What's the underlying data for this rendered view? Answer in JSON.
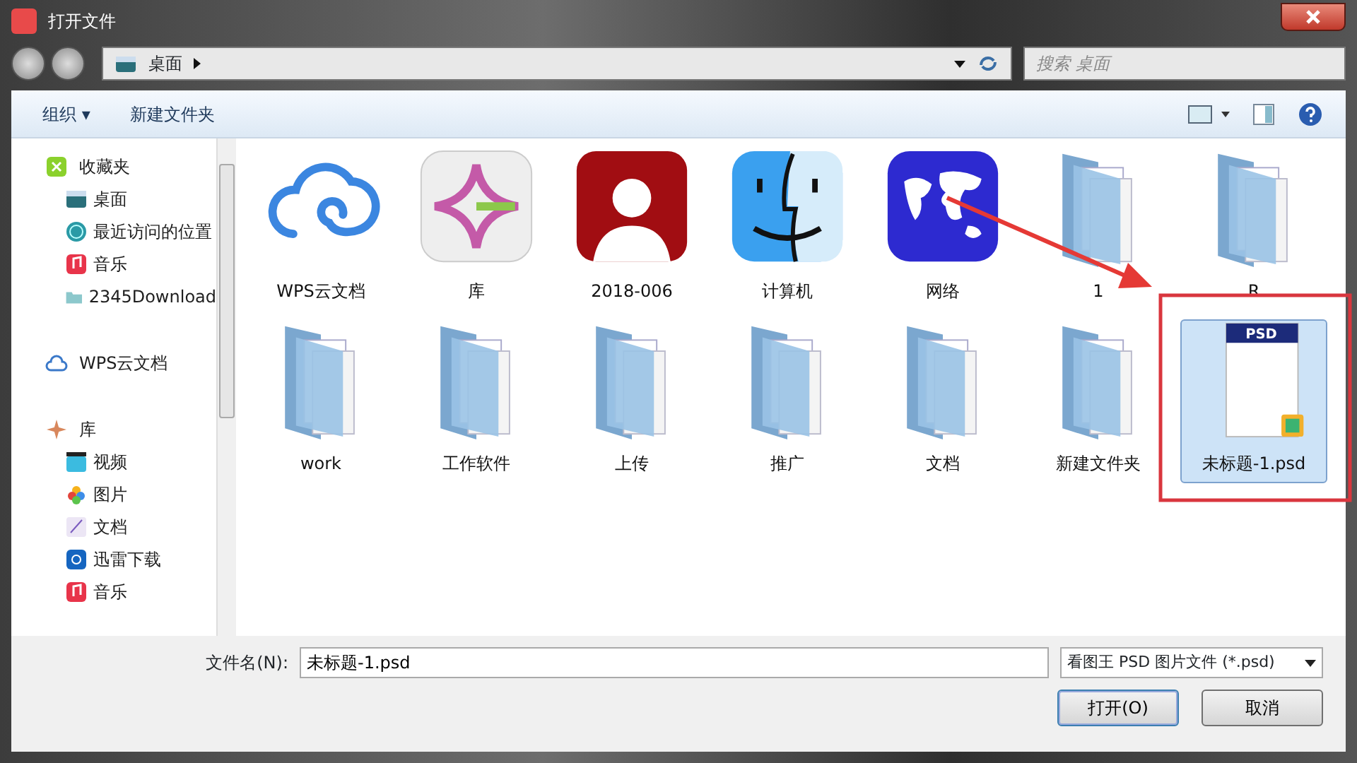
{
  "window": {
    "title": "打开文件"
  },
  "address": {
    "path": "桌面",
    "placeholder": "搜索 桌面"
  },
  "toolbar": {
    "buttons": [
      "组织 ▾",
      "新建文件夹"
    ]
  },
  "sidebar": [
    {
      "label": "收藏夹",
      "kind": "favorites",
      "children": [
        {
          "label": "桌面",
          "kind": "desktop"
        },
        {
          "label": "最近访问的位置",
          "kind": "recent"
        },
        {
          "label": "音乐",
          "kind": "music"
        },
        {
          "label": "2345Download",
          "kind": "folder"
        }
      ]
    },
    {
      "label": "WPS云文档",
      "kind": "cloud"
    },
    {
      "label": "库",
      "kind": "library",
      "children": [
        {
          "label": "视频",
          "kind": "video"
        },
        {
          "label": "图片",
          "kind": "pictures"
        },
        {
          "label": "文档",
          "kind": "docs"
        },
        {
          "label": "迅雷下载",
          "kind": "download"
        },
        {
          "label": "音乐",
          "kind": "music"
        }
      ]
    }
  ],
  "files": [
    {
      "label": "WPS云文档",
      "kind": "cloud",
      "selected": false
    },
    {
      "label": "库",
      "kind": "library",
      "selected": false
    },
    {
      "label": "2018-006",
      "kind": "person",
      "selected": false
    },
    {
      "label": "计算机",
      "kind": "finder",
      "selected": false
    },
    {
      "label": "网络",
      "kind": "globe",
      "selected": false
    },
    {
      "label": "1",
      "kind": "folder",
      "selected": false
    },
    {
      "label": "R",
      "kind": "folder",
      "selected": false
    },
    {
      "label": "work",
      "kind": "folder",
      "selected": false
    },
    {
      "label": "工作软件",
      "kind": "folder",
      "selected": false
    },
    {
      "label": "上传",
      "kind": "folder",
      "selected": false
    },
    {
      "label": "推广",
      "kind": "folder",
      "selected": false
    },
    {
      "label": "文档",
      "kind": "folder",
      "selected": false
    },
    {
      "label": "新建文件夹",
      "kind": "folder",
      "selected": false
    },
    {
      "label": "未标题-1.psd",
      "kind": "psd",
      "icon_text": "PSD",
      "selected": true
    }
  ],
  "footer": {
    "filename_label": "文件名(N):",
    "filename": "未标题-1.psd",
    "filetype": "看图王 PSD 图片文件 (*.psd)",
    "buttons": [
      "打开(O)",
      "取消"
    ]
  }
}
